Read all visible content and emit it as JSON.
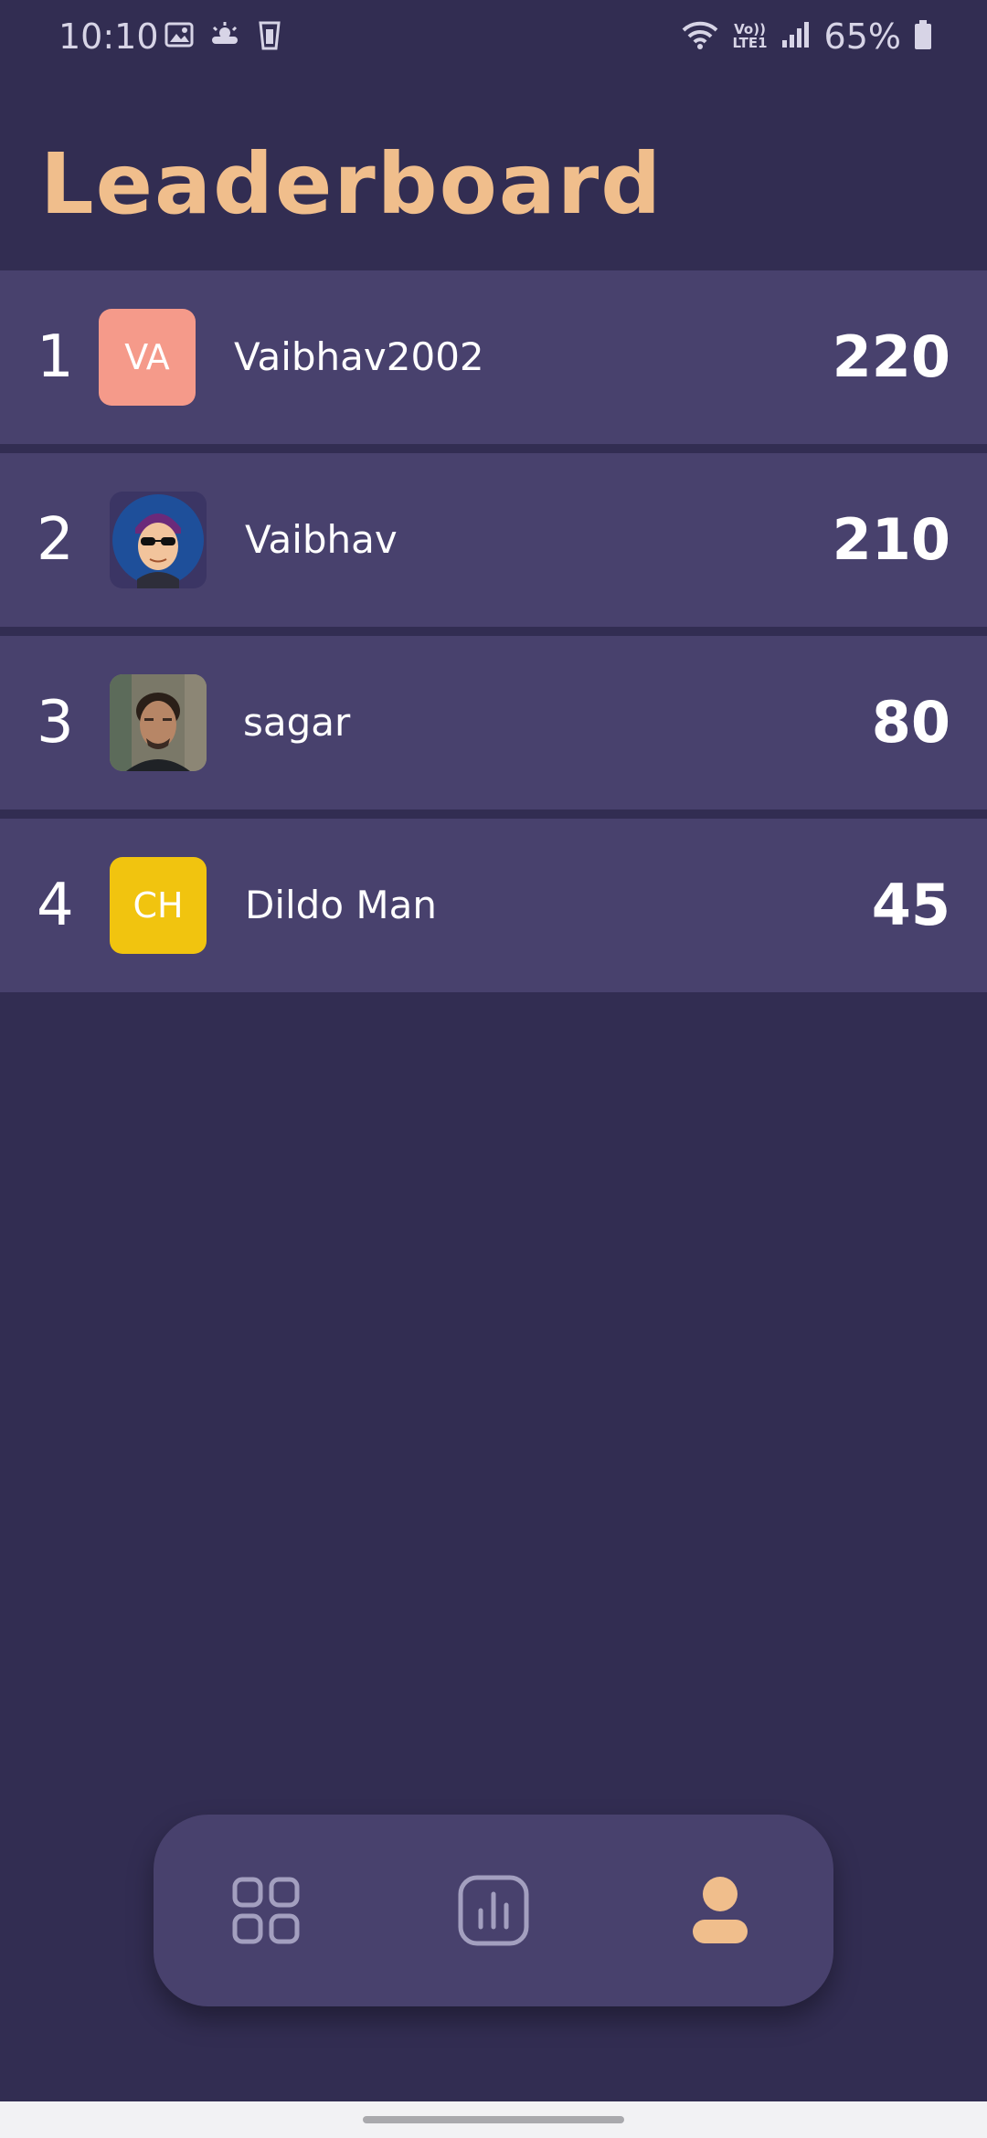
{
  "status_bar": {
    "time": "10:10",
    "battery": "65%",
    "network_label": "Vo))\nLTE1"
  },
  "page": {
    "title": "Leaderboard"
  },
  "leaderboard": [
    {
      "rank": "1",
      "avatar_initials": "VA",
      "avatar_color": "#f59a8a",
      "avatar_type": "initials",
      "name": "Vaibhav2002",
      "score": "220"
    },
    {
      "rank": "2",
      "avatar_initials": "",
      "avatar_color": "#1e4f9a",
      "avatar_type": "photo",
      "name": "Vaibhav",
      "score": "210"
    },
    {
      "rank": "3",
      "avatar_initials": "",
      "avatar_color": "#5a5a55",
      "avatar_type": "photo",
      "name": "sagar",
      "score": "80"
    },
    {
      "rank": "4",
      "avatar_initials": "CH",
      "avatar_color": "#f1c40f",
      "avatar_type": "initials",
      "name": "Dildo Man",
      "score": "45"
    }
  ],
  "bottom_nav": {
    "items": [
      {
        "icon": "grid-icon",
        "active": false
      },
      {
        "icon": "stats-icon",
        "active": false
      },
      {
        "icon": "profile-icon",
        "active": true
      }
    ],
    "active_color": "#f0be8c",
    "inactive_color": "#a39fbf"
  },
  "colors": {
    "background": "#322d52",
    "row": "#48416d",
    "accent": "#f0be8c"
  }
}
